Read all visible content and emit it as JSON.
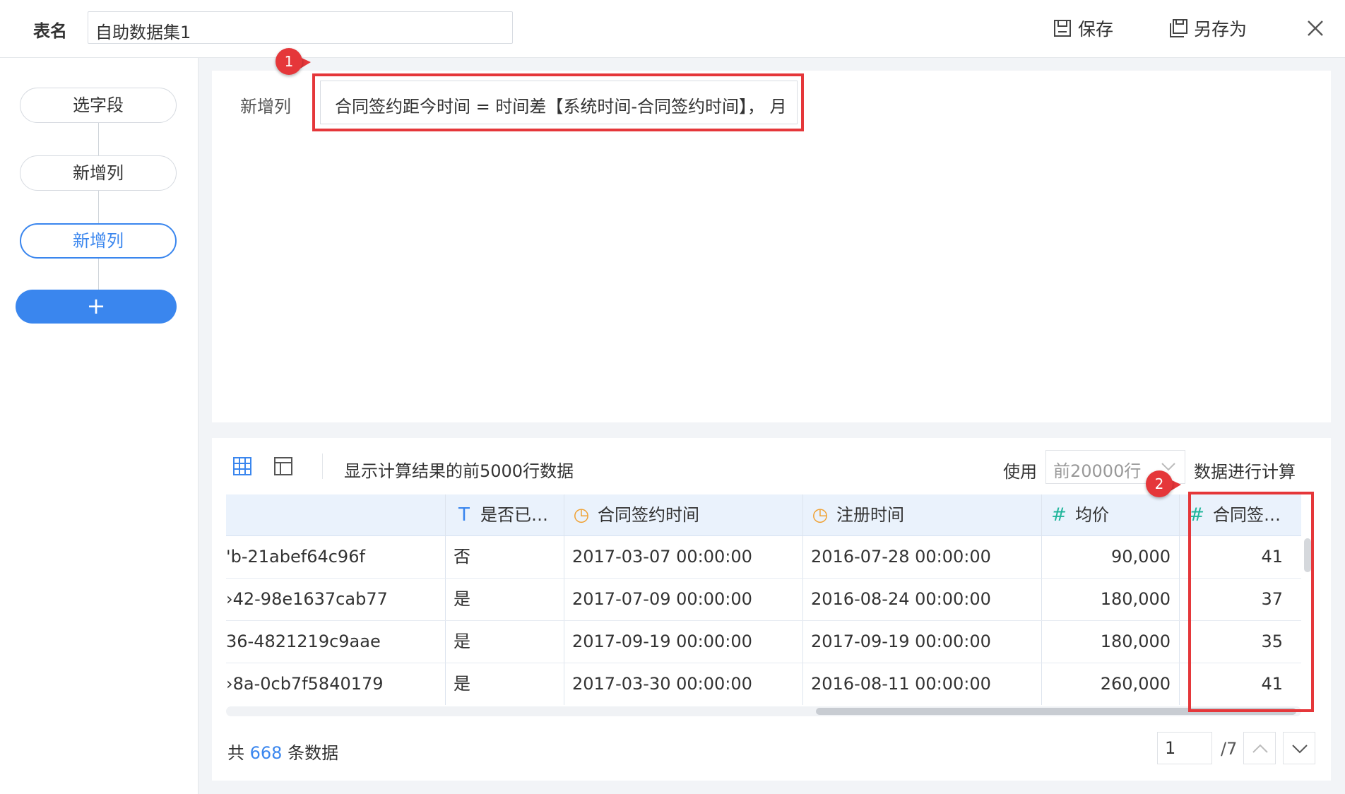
{
  "header": {
    "table_name_label": "表名",
    "table_name_value": "自助数据集1",
    "save_label": "保存",
    "save_as_label": "另存为"
  },
  "flow": {
    "steps": [
      {
        "label": "选字段"
      },
      {
        "label": "新增列"
      },
      {
        "label": "新增列",
        "active": true
      }
    ],
    "add_label": "+"
  },
  "editor": {
    "new_column_label": "新增列",
    "formula": "合同签约距今时间 = 时间差【系统时间-合同签约时间】， 月"
  },
  "annotations": {
    "marker1": "1",
    "marker2": "2",
    "color": "#e5373a"
  },
  "preview": {
    "info": "显示计算结果的前5000行数据",
    "use_label": "使用",
    "rows_option": "前20000行",
    "calc_label": "数据进行计算",
    "columns": [
      {
        "name": "",
        "type": ""
      },
      {
        "name": "是否已…",
        "type": "text",
        "icon": "T"
      },
      {
        "name": "合同签约时间",
        "type": "time",
        "icon": "◷"
      },
      {
        "name": "注册时间",
        "type": "time",
        "icon": "◷"
      },
      {
        "name": "均价",
        "type": "number",
        "icon": "#"
      },
      {
        "name": "合同签…",
        "type": "number",
        "icon": "#"
      }
    ],
    "rows": [
      [
        "'b-21abef64c96f",
        "否",
        "2017-03-07 00:00:00",
        "2016-07-28 00:00:00",
        "90,000",
        "41"
      ],
      [
        "›42-98e1637cab77",
        "是",
        "2017-07-09 00:00:00",
        "2016-08-24 00:00:00",
        "180,000",
        "37"
      ],
      [
        "36-4821219c9aae",
        "是",
        "2017-09-19 00:00:00",
        "2017-09-19 00:00:00",
        "180,000",
        "35"
      ],
      [
        "›8a-0cb7f5840179",
        "是",
        "2017-03-30 00:00:00",
        "2016-08-11 00:00:00",
        "260,000",
        "41"
      ]
    ],
    "total_prefix": "共",
    "total_count": "668",
    "total_suffix": "条数据",
    "page_current": "1",
    "page_total": "/7"
  },
  "colors": {
    "accent": "#3a86ee",
    "header_row": "#eaf2fc",
    "annotation": "#e5373a"
  }
}
